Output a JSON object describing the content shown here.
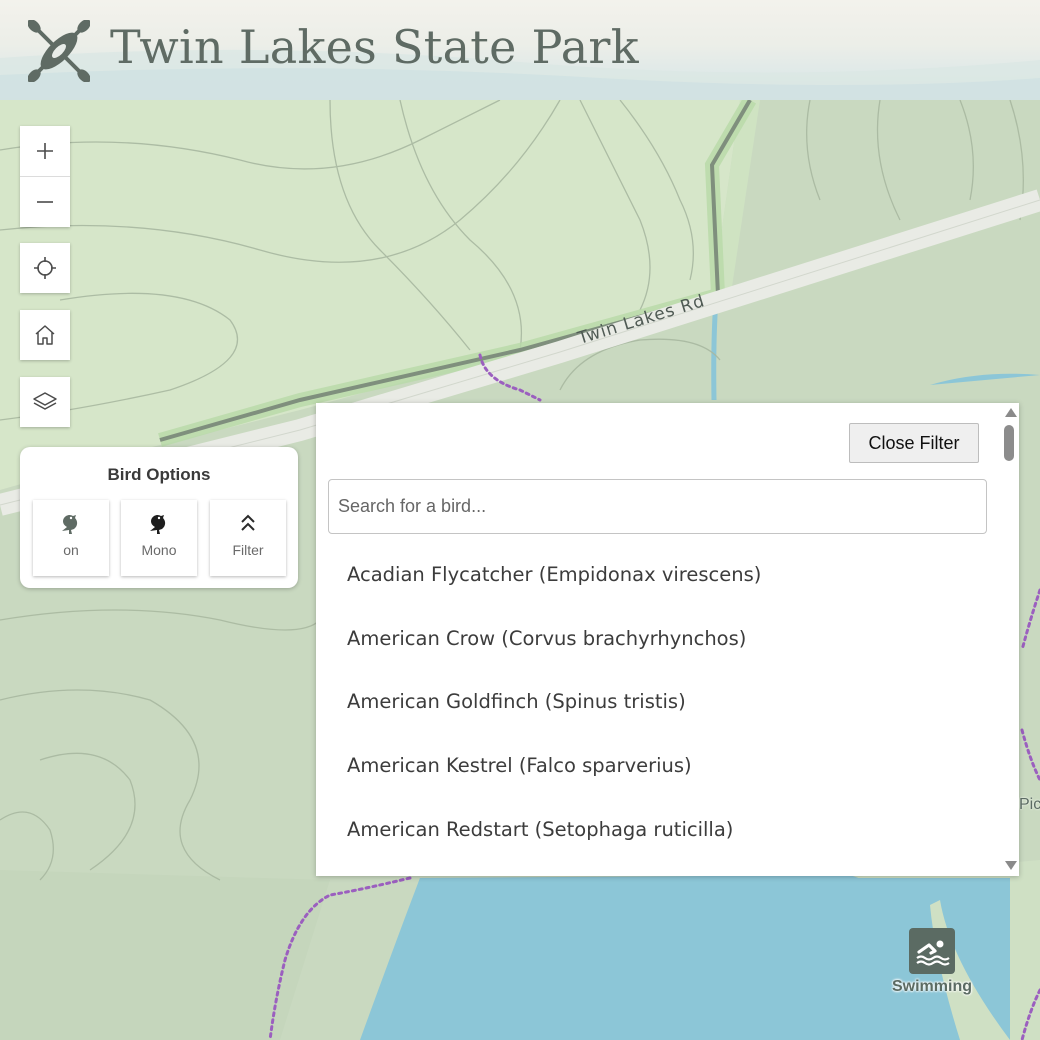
{
  "header": {
    "title": "Twin Lakes State Park",
    "logo_icon": "kayak-paddles-icon"
  },
  "map": {
    "road_label": "Twin Lakes Rd",
    "poi_swimming_label": "Swimming",
    "poi_partial_label": "Pic",
    "colors": {
      "land": "#c9d9c0",
      "forest": "#d6e6c9",
      "water": "#8cc6d7",
      "road": "#e9ebe5",
      "trail": "#9b5fbf"
    }
  },
  "controls": {
    "zoom_in_icon": "plus-icon",
    "zoom_out_icon": "minus-icon",
    "locate_icon": "crosshair-icon",
    "home_icon": "home-icon",
    "layers_icon": "layers-icon"
  },
  "bird_options": {
    "title": "Bird Options",
    "buttons": [
      {
        "label": "on",
        "icon": "bird-icon"
      },
      {
        "label": "Mono",
        "icon": "bird-icon"
      },
      {
        "label": "Filter",
        "icon": "double-chevron-up-icon"
      }
    ]
  },
  "filter": {
    "close_label": "Close Filter",
    "search_placeholder": "Search for a bird...",
    "search_value": "",
    "birds": [
      "Acadian Flycatcher (Empidonax virescens)",
      "American Crow (Corvus brachyrhynchos)",
      "American Goldfinch (Spinus tristis)",
      "American Kestrel (Falco sparverius)",
      "American Redstart (Setophaga ruticilla)"
    ]
  }
}
